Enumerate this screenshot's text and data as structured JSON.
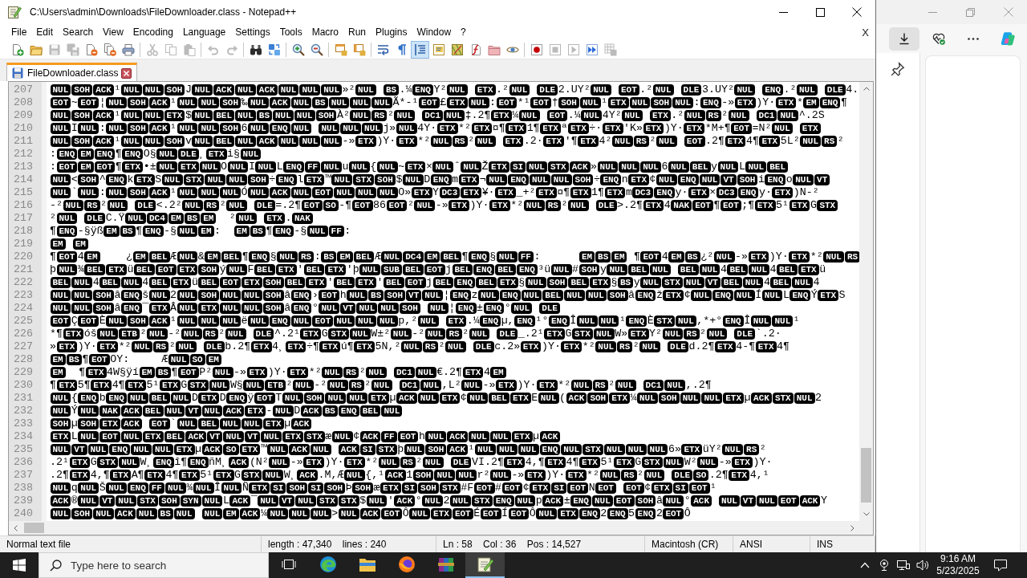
{
  "window": {
    "title": "C:\\Users\\admin\\Downloads\\FileDownloader.class - Notepad++"
  },
  "menu": [
    "File",
    "Edit",
    "Search",
    "View",
    "Encoding",
    "Language",
    "Settings",
    "Tools",
    "Macro",
    "Run",
    "Plugins",
    "Window",
    "?"
  ],
  "menu_close": "X",
  "toolbar": [
    [
      {
        "pressed": false,
        "disabled": false
      },
      {
        "pressed": false,
        "disabled": false
      },
      {
        "pressed": false,
        "disabled": true
      },
      {
        "pressed": false,
        "disabled": true
      },
      {
        "pressed": false,
        "disabled": false
      },
      {
        "pressed": false,
        "disabled": false
      },
      {
        "pressed": false,
        "disabled": false
      }
    ],
    [
      {
        "pressed": false,
        "disabled": true
      },
      {
        "pressed": false,
        "disabled": true
      },
      {
        "pressed": false,
        "disabled": true
      }
    ],
    [
      {
        "pressed": false,
        "disabled": true
      },
      {
        "pressed": false,
        "disabled": true
      }
    ],
    [
      {
        "pressed": false,
        "disabled": false
      },
      {
        "pressed": false,
        "disabled": false
      }
    ],
    [
      {
        "pressed": false,
        "disabled": false
      },
      {
        "pressed": false,
        "disabled": false
      }
    ],
    [
      {
        "pressed": false,
        "disabled": false
      },
      {
        "pressed": false,
        "disabled": false
      }
    ],
    [
      {
        "pressed": false,
        "disabled": false
      },
      {
        "pressed": false,
        "disabled": false
      },
      {
        "pressed": true,
        "disabled": false
      },
      {
        "pressed": false,
        "disabled": false
      },
      {
        "pressed": false,
        "disabled": false
      },
      {
        "pressed": false,
        "disabled": false
      },
      {
        "pressed": false,
        "disabled": false
      },
      {
        "pressed": false,
        "disabled": false
      }
    ],
    [
      {
        "pressed": false,
        "disabled": false
      },
      {
        "pressed": false,
        "disabled": true
      },
      {
        "pressed": false,
        "disabled": true
      },
      {
        "pressed": false,
        "disabled": false
      },
      {
        "pressed": false,
        "disabled": true
      }
    ]
  ],
  "tabs": [
    {
      "label": "FileDownloader.class",
      "selected": true
    }
  ],
  "editor": {
    "lines": [
      {
        "number": "207",
        "segments": [
          [
            "NUL",
            "SOH",
            "ACK"
          ],
          "¹",
          [
            "NUL",
            "NUL",
            "SOH"
          ],
          "J",
          [
            "NUL",
            "ACK",
            "NUL",
            "ACK",
            "NUL",
            "NUL",
            "NUL"
          ],
          "»²",
          [
            "NUL"
          ],
          [
            "BS"
          ],
          ".¼",
          [
            "ENQ"
          ],
          "Y²",
          [
            "NUL"
          ],
          [
            "ETX"
          ],
          ".²",
          [
            "NUL"
          ],
          [
            "DLE"
          ],
          "2.UY²",
          [
            "NUL"
          ],
          [
            "EOT"
          ],
          ".²",
          [
            "NUL"
          ],
          [
            "DLE"
          ],
          "3.UY²",
          [
            "NUL"
          ],
          [
            "ENQ"
          ],
          ".²",
          [
            "NUL"
          ],
          [
            "DLE"
          ],
          "4."
        ]
      },
      {
        "number": "208",
        "segments": [
          [
            "EOT"
          ],
          "~",
          [
            "EOT"
          ],
          "¦",
          [
            "NUL",
            "SOH",
            "ACK"
          ],
          "¹",
          [
            "NUL",
            "NUL",
            "SOH"
          ],
          "‰",
          [
            "NUL",
            "ACK",
            "NUL",
            "BS",
            "NUL",
            "NUL",
            "NUL"
          ],
          "Ã*-¹",
          [
            "EOT"
          ],
          "£",
          [
            "ETX",
            "NUL"
          ],
          ":",
          [
            "EOT"
          ],
          "*¹",
          [
            "EOT"
          ],
          "†",
          [
            "SOH",
            "NUL"
          ],
          "¹",
          [
            "ETX",
            "NUL",
            "SOH",
            "NUL"
          ],
          ":",
          [
            "ENQ"
          ],
          "-»",
          [
            "ETX"
          ],
          ")Y·",
          [
            "ETX"
          ],
          "*",
          [
            "EM",
            "ENQ"
          ],
          "¶"
        ]
      },
      {
        "number": "209",
        "segments": [
          [
            "NUL",
            "SOH",
            "ACK"
          ],
          "¹",
          [
            "NUL",
            "NUL",
            "ETX"
          ],
          "$",
          [
            "NUL",
            "BEL",
            "NUL",
            "BS",
            "NUL",
            "NUL",
            "SOH"
          ],
          "À²",
          [
            "NUL",
            "RS"
          ],
          "²",
          [
            "NUL"
          ],
          [
            "DC1",
            "NUL"
          ],
          "‡.2¶",
          [
            "ETX"
          ],
          "¼",
          [
            "NUL"
          ],
          [
            "EOT"
          ],
          ".¼",
          [
            "NUL"
          ],
          "4Y²",
          [
            "NUL"
          ],
          [
            "ETX"
          ],
          ".²",
          [
            "NUL",
            "RS"
          ],
          "²",
          [
            "NUL"
          ],
          [
            "DC1",
            "NUL"
          ],
          "^.2S"
        ]
      },
      {
        "number": "210",
        "segments": [
          [
            "NUL"
          ],
          "I",
          [
            "NUL"
          ],
          ":",
          [
            "NUL",
            "SOH",
            "ACK"
          ],
          "¹",
          [
            "NUL",
            "NUL",
            "SOH"
          ],
          "6",
          [
            "NUL",
            "ENQ",
            "NUL"
          ],
          [
            "NUL",
            "NUL",
            "NUL"
          ],
          "j»",
          [
            "NUL"
          ],
          "4Y·",
          [
            "ETX"
          ],
          "*²",
          [
            "ETX"
          ],
          "¤¶",
          [
            "ETX"
          ],
          "1¶",
          [
            "ETX"
          ],
          "ª",
          [
            "ETX"
          ],
          "÷·",
          [
            "ETX"
          ],
          "'K»",
          [
            "ETX"
          ],
          ")Y·",
          [
            "ETX"
          ],
          "*M+¶",
          [
            "EOT"
          ],
          "=N²",
          [
            "NUL"
          ],
          [
            "ETX"
          ]
        ]
      },
      {
        "number": "211",
        "segments": [
          [
            "NUL",
            "SOH",
            "ACK"
          ],
          "¹",
          [
            "NUL",
            "NUL",
            "SOH"
          ],
          "v",
          [
            "NUL",
            "BEL",
            "NUL",
            "ACK",
            "NUL",
            "NUL",
            "NUL"
          ],
          "-»",
          [
            "ETX"
          ],
          ")Y·",
          [
            "ETX"
          ],
          "*²",
          [
            "NUL",
            "RS"
          ],
          "²",
          [
            "NUL"
          ],
          [
            "ETX"
          ],
          ".2·",
          [
            "ETX"
          ],
          "'¶",
          [
            "ETX"
          ],
          "4²",
          [
            "NUL",
            "RS"
          ],
          "²",
          [
            "NUL"
          ],
          [
            "EOT"
          ],
          ".2¶",
          [
            "ETX"
          ],
          "4¶",
          [
            "ETX"
          ],
          "5L²",
          [
            "NUL",
            "RS"
          ],
          "²"
        ]
      },
      {
        "number": "212",
        "segments": [
          ":",
          [
            "ENQ",
            "EM",
            "ENQ"
          ],
          "¶",
          [
            "ENQ"
          ],
          "O§",
          [
            "NUL",
            "DLE"
          ],
          "¸",
          [
            "ETX"
          ],
          "i§",
          [
            "NUL"
          ]
        ]
      },
      {
        "number": "213",
        "segments": [
          ":",
          [
            "EOT",
            "EM",
            "EOT"
          ],
          "¶",
          [
            "ETX"
          ],
          "•±",
          [
            "NUL",
            "ETX",
            "NUL"
          ],
          "O",
          [
            "NUL"
          ],
          "I",
          [
            "NUL"
          ],
          "L",
          [
            "ENQ",
            "FF",
            "NUL"
          ],
          "u",
          [
            "NUL"
          ],
          "{",
          [
            "NUL"
          ],
          "~",
          [
            "ETX"
          ],
          "×",
          [
            "NUL"
          ],
          "ˆ",
          [
            "NUL"
          ],
          "Ž",
          [
            "ETX",
            "SI",
            "NUL",
            "STX",
            "ACK"
          ],
          "»",
          [
            "NUL",
            "NUL",
            "NUL"
          ],
          "6",
          [
            "NUL",
            "BEL"
          ],
          "y",
          [
            "NUL"
          ],
          "L",
          [
            "NUL",
            "BEL"
          ]
        ]
      },
      {
        "number": "214",
        "segments": [
          [
            "NUL"
          ],
          "<",
          [
            "SOH"
          ],
          "^",
          [
            "ENQ"
          ],
          "k",
          [
            "ETX"
          ],
          "S",
          [
            "NUL",
            "STX",
            "NUL",
            "NUL",
            "SOH"
          ],
          "÷",
          [
            "ENQ"
          ],
          "l",
          [
            "ETX"
          ],
          "™",
          [
            "NUL",
            "STX",
            "SOH"
          ],
          "$",
          [
            "NUL"
          ],
          "D",
          [
            "ENQ"
          ],
          "m",
          [
            "ETX"
          ],
          "¬",
          [
            "NUL",
            "ENQ",
            "NUL",
            "NUL",
            "SOH"
          ],
          "÷",
          [
            "ENQ"
          ],
          "n",
          [
            "ETX"
          ],
          "¢",
          [
            "NUL",
            "ENQ",
            "NUL",
            "VT",
            "SOH"
          ],
          "i",
          [
            "ENQ"
          ],
          "o",
          [
            "NUL",
            "VT"
          ]
        ]
      },
      {
        "number": "215",
        "segments": [
          [
            "NUL"
          ],
          "`",
          [
            "NUL"
          ],
          ":",
          [
            "NUL",
            "SOH",
            "ACK"
          ],
          "¹",
          [
            "NUL",
            "NUL",
            "NUL"
          ],
          "Ó",
          [
            "NUL",
            "ACK",
            "NUL",
            "EOT",
            "NUL",
            "NUL",
            "NUL"
          ],
          "O»",
          [
            "ETX"
          ],
          "Y",
          [
            "DC3",
            "ETX"
          ],
          "¥·",
          [
            "ETX"
          ],
          "_+²",
          [
            "ETX"
          ],
          "¤¶",
          [
            "ETX"
          ],
          "1¶",
          [
            "ETX"
          ],
          "m",
          [
            "DC3",
            "ENQ"
          ],
          "y·",
          [
            "ETX"
          ],
          "×",
          [
            "DC3",
            "ENQ"
          ],
          "y·",
          [
            "ETX"
          ],
          ")N-²"
        ]
      },
      {
        "number": "216",
        "segments": [
          "-²",
          [
            "NUL",
            "RS"
          ],
          "²",
          [
            "NUL"
          ],
          [
            "DLE"
          ],
          "<.2²",
          [
            "NUL",
            "RS"
          ],
          "²",
          [
            "NUL"
          ],
          [
            "DLE"
          ],
          "=.2¶",
          [
            "EOT",
            "SO"
          ],
          "-¶",
          [
            "EOT"
          ],
          "86",
          [
            "EOT"
          ],
          "²",
          [
            "NUL"
          ],
          "-»",
          [
            "ETX"
          ],
          ")Y·",
          [
            "ETX"
          ],
          "*²",
          [
            "NUL",
            "RS"
          ],
          "²",
          [
            "NUL"
          ],
          [
            "DLE"
          ],
          ">.2¶",
          [
            "ETX"
          ],
          "4",
          [
            "NAK",
            "EOT"
          ],
          "¶",
          [
            "EOT"
          ],
          ";¶",
          [
            "ETX"
          ],
          "5¹",
          [
            "ETX"
          ],
          "G",
          [
            "STX"
          ]
        ]
      },
      {
        "number": "217",
        "segments": [
          "²",
          [
            "NUL"
          ],
          [
            "DLE"
          ],
          "C.Ÿ",
          [
            "NUL",
            "DC4",
            "EM",
            "BS",
            "EM"
          ],
          "  ²",
          [
            "NUL"
          ],
          [
            "ETX"
          ],
          ".",
          [
            "NAK"
          ]
        ]
      },
      {
        "number": "218",
        "segments": [
          "¶",
          [
            "ENQ"
          ],
          "-§ÿß",
          [
            "EM",
            "BS"
          ],
          "¶",
          [
            "ENQ"
          ],
          "-§",
          [
            "NUL",
            "EM"
          ],
          ":  ",
          [
            "EM",
            "BS"
          ],
          "¶",
          [
            "ENQ"
          ],
          "-§",
          [
            "NUL",
            "FF"
          ],
          ":"
        ]
      },
      {
        "number": "219",
        "segments": [
          [
            "EM"
          ],
          [
            "EM"
          ]
        ]
      },
      {
        "number": "220",
        "segments": [
          "¶",
          [
            "EOT"
          ],
          "4",
          [
            "EM"
          ],
          "    ¿",
          [
            "EM",
            "BEL"
          ],
          "Æ",
          [
            "NUL"
          ],
          "&",
          [
            "EM",
            "BEL"
          ],
          "¶",
          [
            "ENQ"
          ],
          "§",
          [
            "NUL",
            "RS"
          ],
          ":",
          [
            "BS",
            "EM",
            "BEL"
          ],
          "Æ",
          [
            "NUL",
            "DC4",
            "EM",
            "BEL"
          ],
          "¶",
          [
            "ENQ"
          ],
          "§",
          [
            "NUL",
            "FF"
          ],
          ":      ",
          [
            "EM",
            "BS",
            "EM"
          ],
          " ¶",
          [
            "EOT"
          ],
          "4",
          [
            "EM",
            "BS"
          ],
          "¿²",
          [
            "NUL"
          ],
          "-»",
          [
            "ETX"
          ],
          ")Y·",
          [
            "ETX"
          ],
          "*²",
          [
            "NUL",
            "RS"
          ]
        ]
      },
      {
        "number": "221",
        "segments": [
          "þ",
          [
            "NUL"
          ],
          "¾",
          [
            "BEL",
            "ETX"
          ],
          "ü",
          [
            "BEL",
            "EOT",
            "ETX",
            "SOH"
          ],
          "ý",
          [
            "NUL"
          ],
          "F",
          [
            "BEL",
            "ETX"
          ],
          "'",
          [
            "BEL",
            "ETX"
          ],
          "'þ",
          [
            "NUL",
            "SUB",
            "BEL",
            "EOT"
          ],
          "j",
          [
            "BEL",
            "ENQ",
            "BEL",
            "ENQ"
          ],
          "³ü",
          [
            "NUL"
          ],
          "#",
          [
            "SOH"
          ],
          "y",
          [
            "NUL",
            "BEL",
            "NUL"
          ],
          [
            "BEL",
            "NUL"
          ],
          "4",
          [
            "BEL",
            "NUL"
          ],
          "4",
          [
            "BEL",
            "ETX"
          ],
          "ü"
        ]
      },
      {
        "number": "222",
        "segments": [
          [
            "BEL",
            "NUL"
          ],
          "4",
          [
            "BEL",
            "NUL"
          ],
          "4",
          [
            "BEL",
            "ETX"
          ],
          "ü",
          [
            "BEL",
            "EOT",
            "ETX",
            "SOH",
            "BEL",
            "ETX"
          ],
          "'",
          [
            "BEL",
            "ETX"
          ],
          "'",
          [
            "BEL",
            "EOT"
          ],
          "j",
          [
            "BEL",
            "ENQ",
            "BEL",
            "ETX"
          ],
          "§",
          [
            "NUL",
            "SOH",
            "BEL",
            "ETX"
          ],
          "§",
          [
            "BS"
          ],
          "y",
          [
            "NUL",
            "STX",
            "NUL",
            "VT",
            "BEL",
            "NUL"
          ],
          "4",
          [
            "BEL",
            "NUL"
          ],
          "4"
        ]
      },
      {
        "number": "223",
        "segments": [
          [
            "NUL",
            "NUL",
            "SOH"
          ],
          "â",
          [
            "ENQ"
          ],
          "š",
          [
            "NUL"
          ],
          "2",
          [
            "NUL",
            "SOH",
            "NUL",
            "NUL",
            "SOH"
          ],
          "â",
          [
            "ENQ"
          ],
          "›",
          [
            "EOT"
          ],
          "h",
          [
            "NUL",
            "BS",
            "SOH",
            "VT",
            "NUL"
          ],
          "¦",
          [
            "ENQ"
          ],
          "z",
          [
            "NUL",
            "ENQ",
            "NUL",
            "BEL",
            "NUL",
            "NUL",
            "SOH"
          ],
          "â",
          [
            "ENQ"
          ],
          "ž",
          [
            "ETX"
          ],
          "¢",
          [
            "NUL",
            "ENQ",
            "NUL"
          ],
          "Í",
          [
            "NUL"
          ],
          "L",
          [
            "ENQ"
          ],
          "Ý",
          [
            "ETX"
          ],
          "S"
        ]
      },
      {
        "number": "224",
        "segments": [
          [
            "NUL",
            "NUL",
            "SOH"
          ],
          "â",
          [
            "ENQ"
          ],
          "¯",
          [
            "ETX"
          ],
          "Â",
          [
            "NUL",
            "ETX",
            "NUL",
            "NUL",
            "SOH"
          ],
          "â",
          [
            "ENQ"
          ],
          "°",
          [
            "NUL",
            "VT",
            "NUL",
            "NUL",
            "SOH"
          ],
          [
            "NUL"
          ],
          "¦",
          [
            "ENQ"
          ],
          "±",
          [
            "ENQ"
          ],
          "°",
          [
            "NUL"
          ],
          [
            "DLE"
          ]
        ]
      },
      {
        "number": "225",
        "segments": [
          [
            "EOT"
          ],
          "Ç",
          [
            "EOT"
          ],
          "È",
          [
            "NUL",
            "SOH",
            "ACK"
          ],
          "¹",
          [
            "NUL",
            "NUL",
            "NUL"
          ],
          "ë",
          [
            "NUL",
            "ENQ",
            "NUL",
            "EOT",
            "NUL",
            "NUL",
            "NUL"
          ],
          "p,²",
          [
            "NUL"
          ],
          [
            "ETX"
          ],
          ".¼",
          [
            "ENQ"
          ],
          "µ,",
          [
            "ENQ"
          ],
          "¹°",
          [
            "ENQ"
          ],
          "Î",
          [
            "NUL",
            "NUL"
          ],
          "¹",
          [
            "ENQ"
          ],
          "È",
          [
            "STX",
            "NUL"
          ],
          ",*+°",
          [
            "ENQ"
          ],
          "Î",
          [
            "NUL",
            "NUL"
          ],
          "¹"
        ]
      },
      {
        "number": "226",
        "segments": [
          "*¶",
          [
            "ETX"
          ],
          "óš",
          [
            "NUL",
            "ETB"
          ],
          "²",
          [
            "NUL"
          ],
          "-²",
          [
            "NUL",
            "RS"
          ],
          "²",
          [
            "NUL"
          ],
          [
            "DLE"
          ],
          "^.2¹",
          [
            "ETX"
          ],
          "G",
          [
            "STX",
            "NUL"
          ],
          "W±²",
          [
            "NUL"
          ],
          "-²",
          [
            "NUL",
            "RS"
          ],
          "²",
          [
            "NUL"
          ],
          [
            "DLE"
          ],
          "_.2¹",
          [
            "ETX"
          ],
          "G",
          [
            "STX",
            "NUL"
          ],
          "W»",
          [
            "ETX"
          ],
          "Y²",
          [
            "NUL",
            "RS"
          ],
          "²",
          [
            "NUL"
          ],
          [
            "DLE"
          ],
          "`.2·"
        ]
      },
      {
        "number": "227",
        "segments": [
          "»",
          [
            "ETX"
          ],
          ")Y·",
          [
            "ETX"
          ],
          "*²",
          [
            "NUL",
            "RS"
          ],
          "²",
          [
            "NUL"
          ],
          [
            "DLE"
          ],
          "b.2¶",
          [
            "ETX"
          ],
          "4¸",
          [
            "ETX"
          ],
          "÷¶",
          [
            "ETX"
          ],
          "ú¶",
          [
            "ETX"
          ],
          "5N,²",
          [
            "NUL",
            "RS"
          ],
          "²",
          [
            "NUL"
          ],
          [
            "DLE"
          ],
          "c.2»",
          [
            "ETX"
          ],
          ")Y·",
          [
            "ETX"
          ],
          "*²",
          [
            "NUL",
            "RS"
          ],
          "²",
          [
            "NUL"
          ],
          [
            "DLE"
          ],
          "d.2¶",
          [
            "ETX"
          ],
          "4-¶",
          [
            "ETX"
          ],
          "4¶"
        ]
      },
      {
        "number": "228",
        "segments": [
          [
            "EM",
            "BS"
          ],
          "¶",
          [
            "EOT"
          ],
          "OY:     Æ",
          [
            "NUL",
            "SO",
            "EM"
          ]
        ]
      },
      {
        "number": "229",
        "segments": [
          [
            "EM"
          ],
          "  ¶",
          [
            "ETX"
          ],
          "4W§ÿí",
          [
            "EM",
            "BS"
          ],
          "¶",
          [
            "EOT"
          ],
          "P²",
          [
            "NUL"
          ],
          "-»",
          [
            "ETX"
          ],
          ")Y·",
          [
            "ETX"
          ],
          "*²",
          [
            "NUL",
            "RS"
          ],
          "²",
          [
            "NUL"
          ],
          [
            "DC1",
            "NUL"
          ],
          "€.2¶",
          [
            "ETX"
          ],
          "4",
          [
            "EM"
          ]
        ]
      },
      {
        "number": "230",
        "segments": [
          "¶",
          [
            "ETX"
          ],
          "5¶",
          [
            "ETX"
          ],
          "4¶",
          [
            "ETX"
          ],
          "5¹",
          [
            "ETX"
          ],
          "G",
          [
            "STX",
            "NUL"
          ],
          "W§",
          [
            "NUL",
            "ETB"
          ],
          "²",
          [
            "NUL"
          ],
          "-²",
          [
            "NUL",
            "RS"
          ],
          "²",
          [
            "NUL"
          ],
          [
            "DC1",
            "NUL"
          ],
          ",L²",
          [
            "NUL"
          ],
          "-»",
          [
            "ETX"
          ],
          ")Y·",
          [
            "ETX"
          ],
          "*²",
          [
            "NUL",
            "RS"
          ],
          "²",
          [
            "NUL"
          ],
          [
            "DC1",
            "NUL"
          ],
          ",.2¶"
        ]
      },
      {
        "number": "231",
        "segments": [
          [
            "NUL"
          ],
          "{",
          [
            "ENQ"
          ],
          "b",
          [
            "ENQ",
            "NUL",
            "BEL",
            "NUL"
          ],
          "D",
          [
            "ETX"
          ],
          "D",
          [
            "ENQ"
          ],
          "ÿ",
          [
            "EOT"
          ],
          "T",
          [
            "NUL",
            "SOH",
            "NUL",
            "NUL",
            "ETX"
          ],
          "µ",
          [
            "ACK",
            "NUL",
            "ETX"
          ],
          "¢",
          [
            "NUL",
            "BEL",
            "ETX"
          ],
          "E",
          [
            "NUL"
          ],
          "(",
          [
            "ACK",
            "SOH",
            "ETX"
          ],
          "¼",
          [
            "NUL",
            "SOH",
            "NUL",
            "NUL",
            "ETX"
          ],
          "µ",
          [
            "ACK",
            "STX",
            "NUL"
          ],
          "2"
        ]
      },
      {
        "number": "232",
        "segments": [
          [
            "NUL"
          ],
          "Ý",
          [
            "NUL",
            "NAK",
            "ACK",
            "BEL",
            "NUL",
            "VT",
            "NUL",
            "ACK",
            "ETX"
          ],
          "-",
          [
            "NUL"
          ],
          "D",
          [
            "ACK",
            "BS",
            "ENQ",
            "BEL",
            "NUL"
          ]
        ]
      },
      {
        "number": "233",
        "segments": [
          [
            "SOH"
          ],
          "µ",
          [
            "SOH",
            "ETX",
            "ACK"
          ],
          [
            "EOT"
          ],
          "`",
          [
            "NUL",
            "BEL",
            "NUL",
            "NUL",
            "ETX"
          ],
          "µ",
          [
            "ACK"
          ]
        ]
      },
      {
        "number": "234",
        "segments": [
          [
            "ETX"
          ],
          "L",
          [
            "NUL",
            "EOT",
            "NUL",
            "ETX",
            "BEL",
            "ACK",
            "VT",
            "NUL",
            "VT",
            "NUL",
            "ETX",
            "STX"
          ],
          "æ",
          [
            "NUL"
          ],
          "¢",
          [
            "ACK",
            "FF",
            "EOT"
          ],
          "h",
          [
            "NUL",
            "ACK",
            "NUL",
            "NUL",
            "ETX"
          ],
          "µ",
          [
            "ACK"
          ]
        ]
      },
      {
        "number": "235",
        "segments": [
          [
            "NUL",
            "VT",
            "NUL",
            "ENQ",
            "NUL",
            "NUL",
            "ETX"
          ],
          "µ",
          [
            "ACK",
            "SO",
            "ETX"
          ],
          "™",
          [
            "NUL",
            "ACK",
            "NUL"
          ],
          [
            "ACK",
            "SI",
            "STX"
          ],
          "þ",
          [
            "NUL",
            "SOH",
            "ACK"
          ],
          "¹",
          [
            "NUL",
            "NUL",
            "NUL",
            "ENQ",
            "NUL",
            "STX",
            "NUL",
            "NUL",
            "NUL"
          ],
          "6»",
          [
            "ETX"
          ],
          "üY²",
          [
            "NUL",
            "RS"
          ],
          "²"
        ]
      },
      {
        "number": "236",
        "segments": [
          ".2¹",
          [
            "ETX"
          ],
          "G",
          [
            "STX",
            "NUL"
          ],
          "W¸",
          [
            "ENQ"
          ],
          "î¶",
          [
            "ENQ"
          ],
          "ñM¸",
          [
            "ACK"
          ],
          "(N²",
          [
            "NUL"
          ],
          "-»",
          [
            "ETX"
          ],
          ")Y·",
          [
            "ETX"
          ],
          "*²",
          [
            "NUL",
            "RS"
          ],
          "²",
          [
            "NUL"
          ],
          [
            "DLE"
          ],
          "VI.2¶",
          [
            "ETX"
          ],
          "4,¶",
          [
            "ETX"
          ],
          "4¶",
          [
            "ETX"
          ],
          "5¹",
          [
            "ETX"
          ],
          "G",
          [
            "STX",
            "NUL"
          ],
          "W²",
          [
            "NUL"
          ],
          "-»",
          [
            "ETX"
          ],
          ")Y·"
        ]
      },
      {
        "number": "237",
        "segments": [
          ".2¶",
          [
            "ETX"
          ],
          "4,¶",
          [
            "ETX"
          ],
          "A¶",
          [
            "ETX"
          ],
          "4¶",
          [
            "ETX"
          ],
          "5¹",
          [
            "ETX"
          ],
          "G",
          [
            "STX",
            "NUL"
          ],
          "W¸",
          [
            "ACK"
          ],
          ".M,Æ",
          [
            "NUL"
          ],
          "{,¹",
          [
            "ACK"
          ],
          "1",
          [
            "SOH",
            "NUL",
            "NUL"
          ],
          "r²",
          [
            "NUL"
          ],
          "-»",
          [
            "ETX"
          ],
          ")Y·",
          [
            "ETX"
          ],
          "*²",
          [
            "NUL",
            "RS"
          ],
          "²",
          [
            "NUL"
          ],
          [
            "DLE",
            "SO"
          ],
          ".2¶",
          [
            "ETX"
          ],
          "4,¹"
        ]
      },
      {
        "number": "238",
        "segments": [
          [
            "NUL"
          ],
          "q",
          [
            "NUL"
          ],
          "Š",
          [
            "NUL",
            "ENQ",
            "FF",
            "NUL"
          ],
          "¾",
          [
            "NUL"
          ],
          "Î",
          [
            "NUL"
          ],
          "Ñ",
          [
            "ETX",
            "SI",
            "SOH",
            "SI",
            "SOH"
          ],
          "Þ",
          [
            "SOH"
          ],
          "æ",
          [
            "ETX",
            "SI",
            "SOH",
            "STX"
          ],
          "#F",
          [
            "EOT"
          ],
          "#",
          [
            "EOT"
          ],
          "¢",
          [
            "ETX",
            "SI",
            "EOT"
          ],
          "N",
          [
            "EOT"
          ],
          [
            "EOT"
          ],
          "¢",
          [
            "ETX",
            "SI",
            "EOT"
          ],
          "¹"
        ]
      },
      {
        "number": "239",
        "segments": [
          [
            "ACK"
          ],
          "®",
          [
            "NUL",
            "VT",
            "NUL",
            "STX",
            "SOH",
            "SYN",
            "NUL"
          ],
          "L",
          [
            "ACK"
          ],
          "¯",
          [
            "NUL",
            "VT",
            "NUL",
            "STX",
            "STX"
          ],
          "$",
          [
            "NUL"
          ],
          "'",
          [
            "ACK"
          ],
          "°",
          [
            "NUL"
          ],
          "2",
          [
            "NUL",
            "STX",
            "ENQ",
            "NUL"
          ],
          "p",
          [
            "ACK"
          ],
          "±",
          [
            "ENQ",
            "NUL",
            "EOT",
            "SOH"
          ],
          "â",
          [
            "NUL"
          ],
          "°",
          [
            "ACK"
          ],
          [
            "NUL",
            "VT",
            "NUL",
            "EOT",
            "ACK"
          ],
          "Y"
        ]
      },
      {
        "number": "240",
        "segments": [
          [
            "NUL",
            "SOH",
            "NUL",
            "ACK",
            "NUL",
            "BS",
            "NUL"
          ],
          [
            "NUL",
            "EM",
            "ACK"
          ],
          "¼",
          [
            "NUL",
            "NUL",
            "NUL"
          ],
          ">",
          [
            "NUL",
            "ACK",
            "EOT"
          ],
          "Ô",
          [
            "NUL",
            "ETX",
            "EOT"
          ],
          "É",
          [
            "EOT"
          ],
          "Í",
          [
            "EOT"
          ],
          "Ô",
          [
            "NUL",
            "ETX",
            "ENQ"
          ],
          "2",
          [
            "ENQ"
          ],
          "5",
          [
            "ENQ"
          ],
          "2",
          [
            "EOT"
          ],
          "Ô"
        ]
      }
    ]
  },
  "status_bar": [
    "Normal text file",
    "length : 47,340    lines : 240",
    "Ln : 58    Col : 36    Pos : 14,527",
    "Macintosh (CR)",
    "ANSI",
    "INS"
  ],
  "background_window": {
    "toolbar": [
      {
        "pressed": true
      },
      {
        "pressed": false
      },
      {
        "pressed": false
      },
      {
        "pressed": false
      }
    ]
  },
  "taskbar": {
    "search": {
      "placeholder": "Type here to search"
    },
    "apps": [
      {
        "active": false
      },
      {
        "active": false
      },
      {
        "active": false
      },
      {
        "active": false
      },
      {
        "active": false
      },
      {
        "active": true
      }
    ],
    "clock": {
      "time": "9:16 AM",
      "date": "5/23/2025"
    }
  }
}
